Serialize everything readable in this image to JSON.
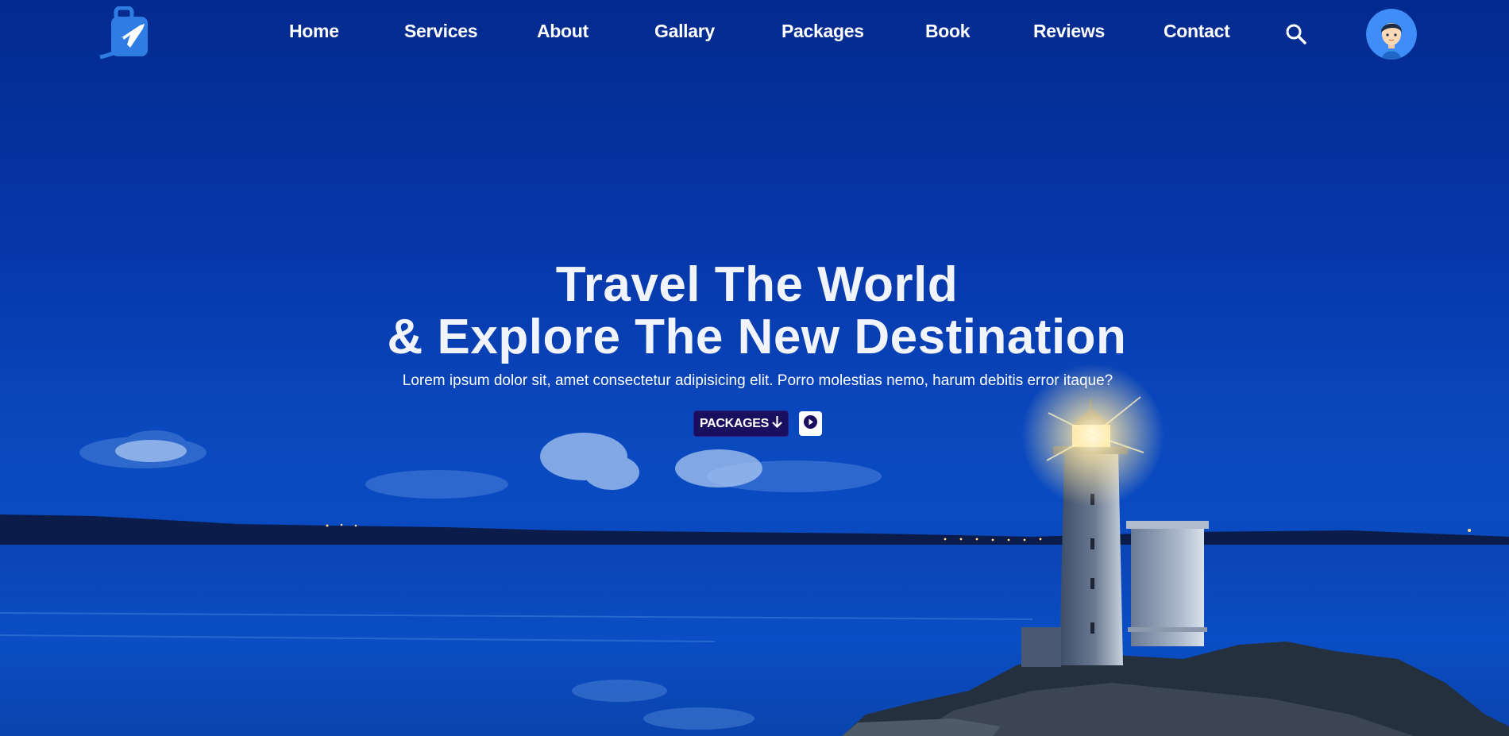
{
  "nav": {
    "items": [
      {
        "label": "Home"
      },
      {
        "label": "Services"
      },
      {
        "label": "About"
      },
      {
        "label": "Gallary"
      },
      {
        "label": "Packages"
      },
      {
        "label": "Book"
      },
      {
        "label": "Reviews"
      },
      {
        "label": "Contact"
      }
    ],
    "logo_icon": "suitcase-airplane-icon",
    "search_icon": "search-icon",
    "avatar_icon": "user-avatar"
  },
  "hero": {
    "title_line1": "Travel The World",
    "title_line2": "& Explore The New Destination",
    "subtitle": "Lorem ipsum dolor sit, amet consectetur adipisicing elit. Porro molestias nemo, harum debitis error itaque?",
    "packages_button": "PACKAGES",
    "packages_arrow": "🡣",
    "play_icon": "play-circle-icon",
    "background": "night-lighthouse-seascape"
  },
  "colors": {
    "sky": "#032a8e",
    "sea": "#0a4bc2",
    "button_dark": "#1a0f5e",
    "text": "#ffffff",
    "avatar_bg": "#3f8df7"
  }
}
